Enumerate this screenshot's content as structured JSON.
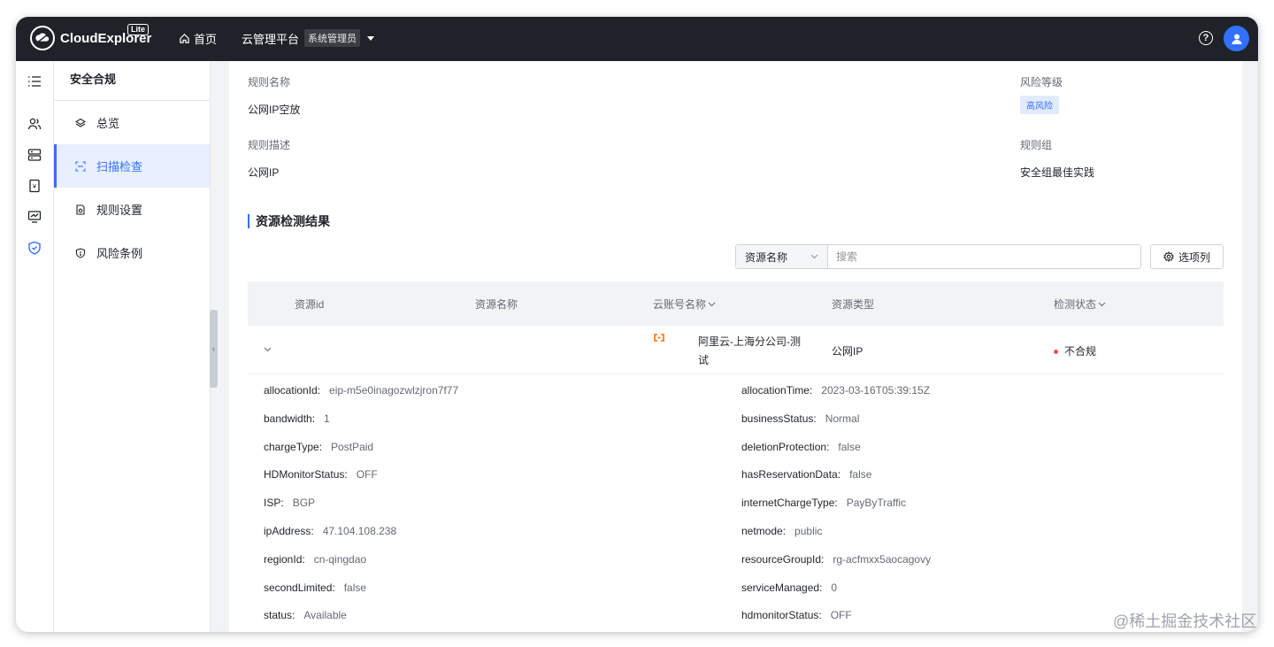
{
  "app": {
    "name": "CloudExplorer",
    "badge": "Lite"
  },
  "topnav": {
    "home": "首页",
    "platform": "云管理平台",
    "role": "系统管理员"
  },
  "submenu": {
    "title": "安全合规",
    "items": [
      {
        "label": "总览",
        "icon": "layers-icon"
      },
      {
        "label": "扫描检查",
        "icon": "scan-icon"
      },
      {
        "label": "规则设置",
        "icon": "document-gear-icon"
      },
      {
        "label": "风险条例",
        "icon": "shield-warning-icon"
      }
    ]
  },
  "rule": {
    "name_label": "规则名称",
    "name": "公网IP空放",
    "risk_label": "风险等级",
    "risk": "高风险",
    "desc_label": "规则描述",
    "desc": "公网IP",
    "group_label": "规则组",
    "group": "安全组最佳实践"
  },
  "results": {
    "title": "资源检测结果",
    "search_field": "资源名称",
    "search_placeholder": "搜索",
    "columns_button": "选项列",
    "headers": [
      "资源id",
      "资源名称",
      "云账号名称",
      "资源类型",
      "检测状态"
    ],
    "row": {
      "account_line1": "阿里云-上海分公司-测",
      "account_line2": "试",
      "type": "公网IP",
      "status": "不合规"
    }
  },
  "details": [
    {
      "k": "allocationId:",
      "v": "eip-m5e0inagozwlzjron7f77",
      "k2": "allocationTime:",
      "v2": "2023-03-16T05:39:15Z"
    },
    {
      "k": "bandwidth:",
      "v": "1",
      "k2": "businessStatus:",
      "v2": "Normal"
    },
    {
      "k": "chargeType:",
      "v": "PostPaid",
      "k2": "deletionProtection:",
      "v2": "false"
    },
    {
      "k": "HDMonitorStatus:",
      "v": "OFF",
      "k2": "hasReservationData:",
      "v2": "false"
    },
    {
      "k": "ISP:",
      "v": "BGP",
      "k2": "internetChargeType:",
      "v2": "PayByTraffic"
    },
    {
      "k": "ipAddress:",
      "v": "47.104.108.238",
      "k2": "netmode:",
      "v2": "public"
    },
    {
      "k": "regionId:",
      "v": "cn-qingdao",
      "k2": "resourceGroupId:",
      "v2": "rg-acfmxx5aocagovy"
    },
    {
      "k": "secondLimited:",
      "v": "false",
      "k2": "serviceManaged:",
      "v2": "0"
    },
    {
      "k": "status:",
      "v": "Available",
      "k2": "hdmonitorStatus:",
      "v2": "OFF"
    }
  ],
  "watermark": "@稀土掘金技术社区",
  "colors": {
    "accent": "#3370ff",
    "topbar": "#1f2329",
    "danger": "#f54a45"
  }
}
